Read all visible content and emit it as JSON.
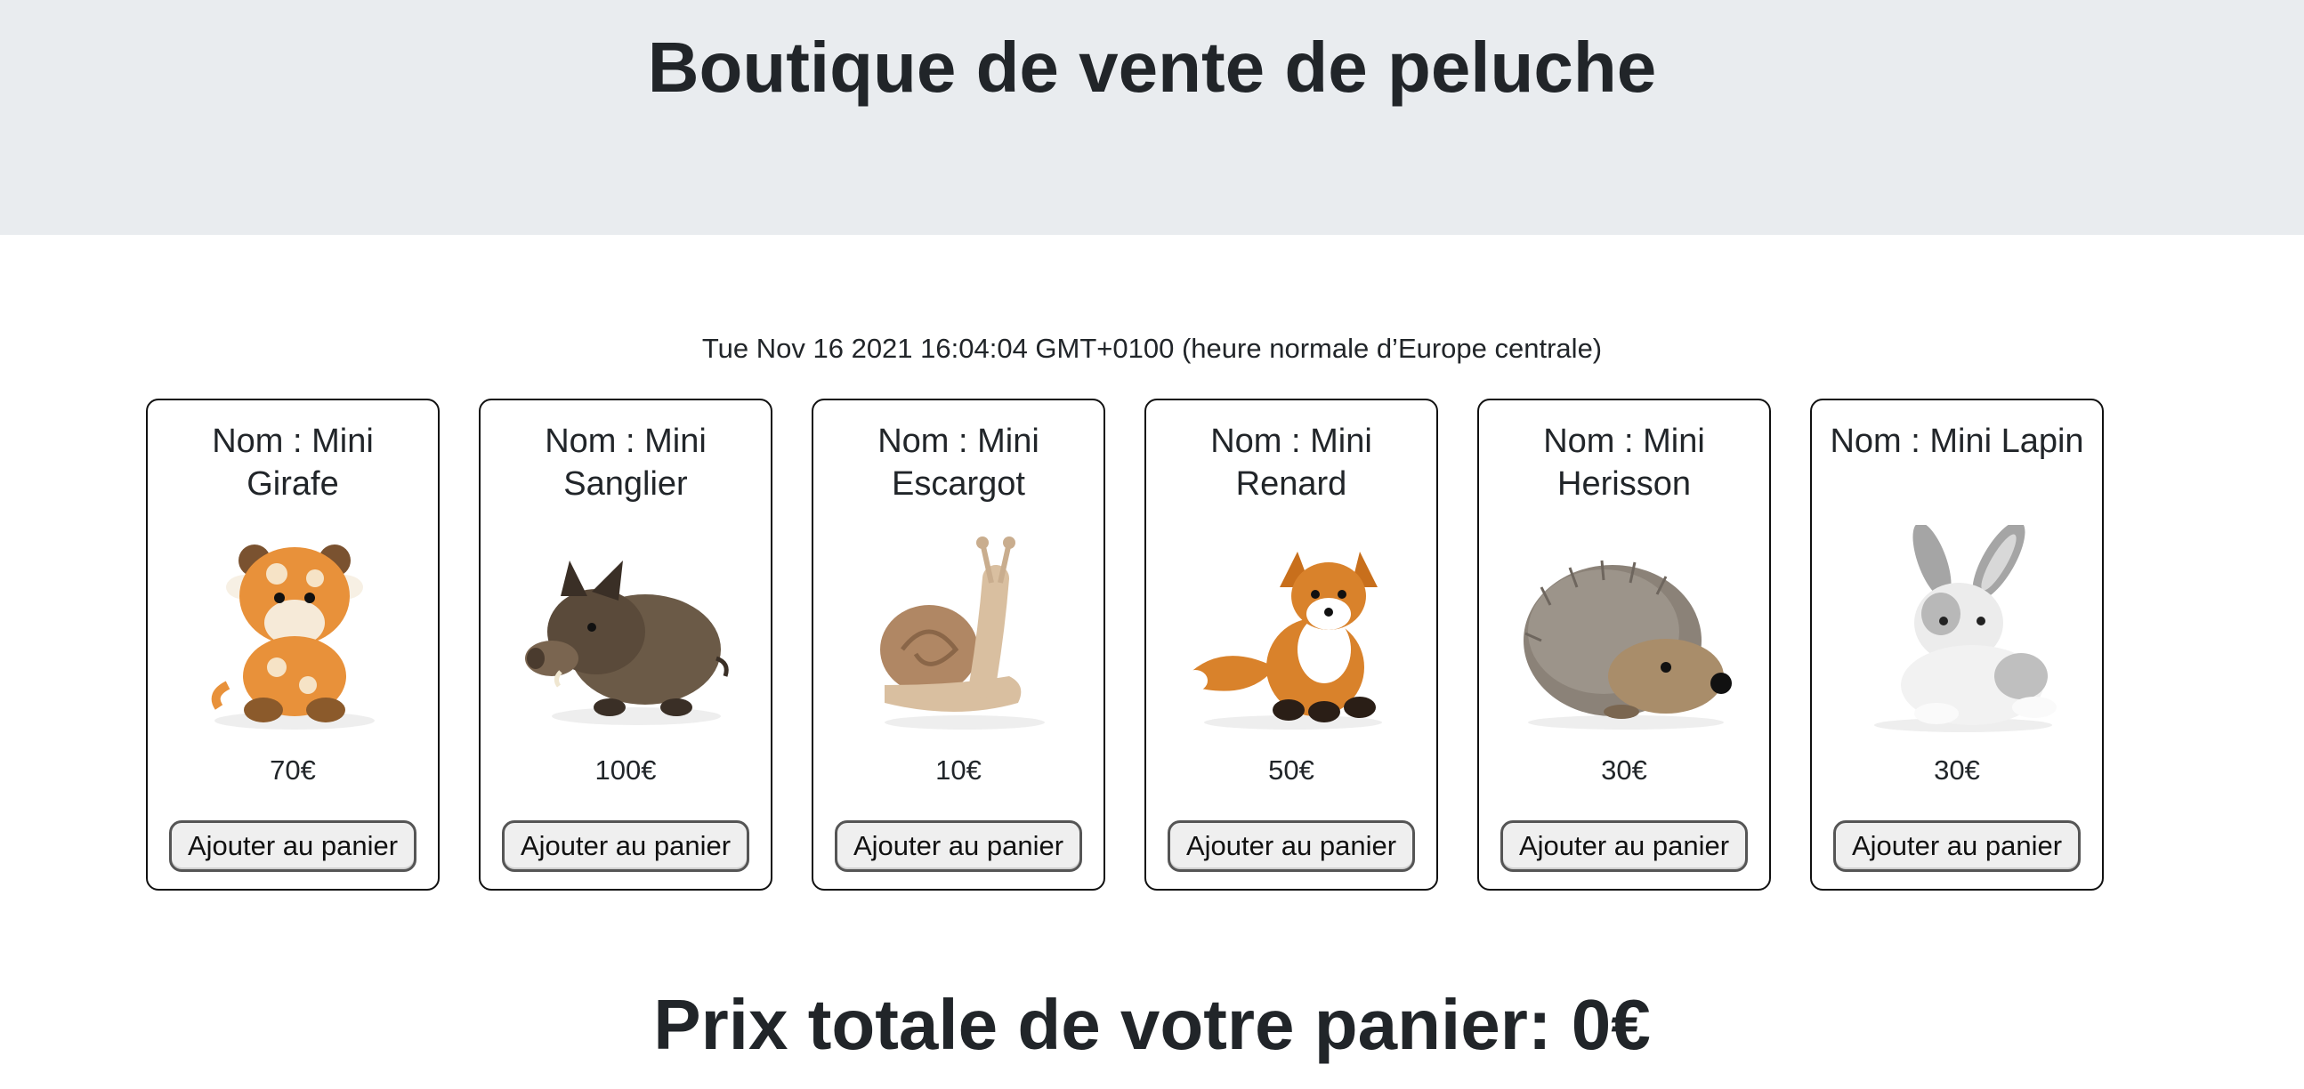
{
  "header": {
    "title": "Boutique de vente de peluche"
  },
  "date_text": "Tue Nov 16 2021 16:04:04 GMT+0100 (heure normale d’Europe centrale)",
  "products": [
    {
      "name": "Nom : Mini Girafe",
      "price": "70€",
      "button": "Ajouter au panier",
      "icon": "giraffe-plush-image"
    },
    {
      "name": "Nom : Mini Sanglier",
      "price": "100€",
      "button": "Ajouter au panier",
      "icon": "boar-plush-image"
    },
    {
      "name": "Nom : Mini Escargot",
      "price": "10€",
      "button": "Ajouter au panier",
      "icon": "snail-plush-image"
    },
    {
      "name": "Nom : Mini Renard",
      "price": "50€",
      "button": "Ajouter au panier",
      "icon": "fox-plush-image"
    },
    {
      "name": "Nom : Mini Herisson",
      "price": "30€",
      "button": "Ajouter au panier",
      "icon": "hedgehog-plush-image"
    },
    {
      "name": "Nom : Mini Lapin",
      "price": "30€",
      "button": "Ajouter au panier",
      "icon": "rabbit-plush-image"
    }
  ],
  "cart": {
    "total_text": "Prix totale de votre panier: 0€"
  },
  "colors": {
    "header_bg": "#e9ecef",
    "text": "#212529",
    "card_border": "#111111",
    "button_bg": "#efefef"
  }
}
